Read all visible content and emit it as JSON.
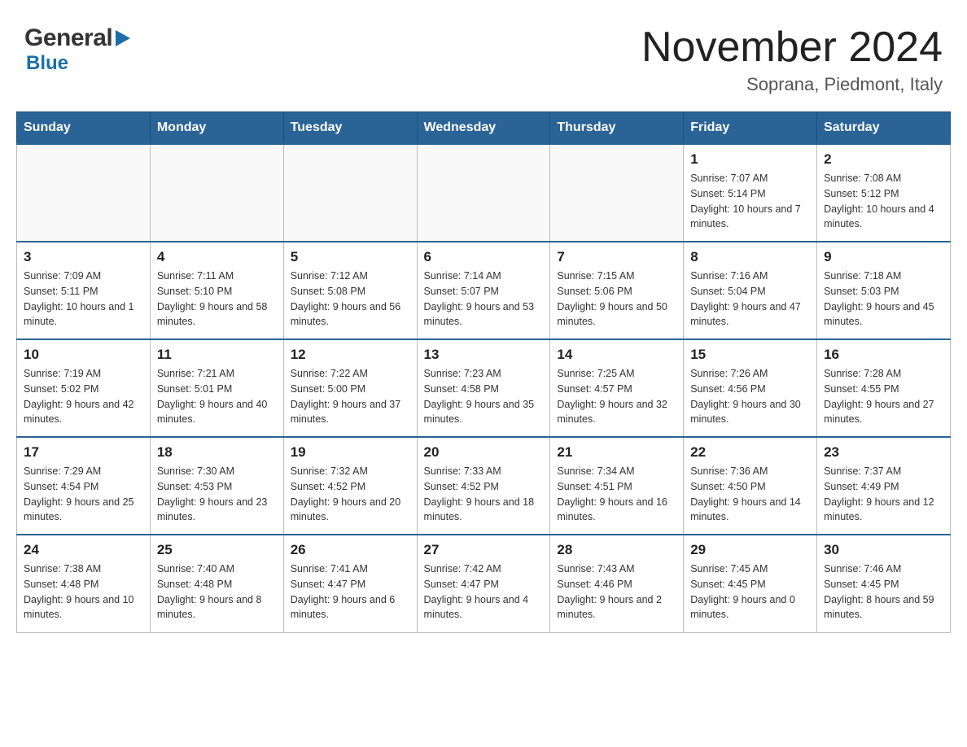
{
  "header": {
    "logo_general": "General",
    "logo_blue": "Blue",
    "month_title": "November 2024",
    "location": "Soprana, Piedmont, Italy"
  },
  "weekdays": [
    "Sunday",
    "Monday",
    "Tuesday",
    "Wednesday",
    "Thursday",
    "Friday",
    "Saturday"
  ],
  "weeks": [
    [
      {
        "day": "",
        "sunrise": "",
        "sunset": "",
        "daylight": ""
      },
      {
        "day": "",
        "sunrise": "",
        "sunset": "",
        "daylight": ""
      },
      {
        "day": "",
        "sunrise": "",
        "sunset": "",
        "daylight": ""
      },
      {
        "day": "",
        "sunrise": "",
        "sunset": "",
        "daylight": ""
      },
      {
        "day": "",
        "sunrise": "",
        "sunset": "",
        "daylight": ""
      },
      {
        "day": "1",
        "sunrise": "Sunrise: 7:07 AM",
        "sunset": "Sunset: 5:14 PM",
        "daylight": "Daylight: 10 hours and 7 minutes."
      },
      {
        "day": "2",
        "sunrise": "Sunrise: 7:08 AM",
        "sunset": "Sunset: 5:12 PM",
        "daylight": "Daylight: 10 hours and 4 minutes."
      }
    ],
    [
      {
        "day": "3",
        "sunrise": "Sunrise: 7:09 AM",
        "sunset": "Sunset: 5:11 PM",
        "daylight": "Daylight: 10 hours and 1 minute."
      },
      {
        "day": "4",
        "sunrise": "Sunrise: 7:11 AM",
        "sunset": "Sunset: 5:10 PM",
        "daylight": "Daylight: 9 hours and 58 minutes."
      },
      {
        "day": "5",
        "sunrise": "Sunrise: 7:12 AM",
        "sunset": "Sunset: 5:08 PM",
        "daylight": "Daylight: 9 hours and 56 minutes."
      },
      {
        "day": "6",
        "sunrise": "Sunrise: 7:14 AM",
        "sunset": "Sunset: 5:07 PM",
        "daylight": "Daylight: 9 hours and 53 minutes."
      },
      {
        "day": "7",
        "sunrise": "Sunrise: 7:15 AM",
        "sunset": "Sunset: 5:06 PM",
        "daylight": "Daylight: 9 hours and 50 minutes."
      },
      {
        "day": "8",
        "sunrise": "Sunrise: 7:16 AM",
        "sunset": "Sunset: 5:04 PM",
        "daylight": "Daylight: 9 hours and 47 minutes."
      },
      {
        "day": "9",
        "sunrise": "Sunrise: 7:18 AM",
        "sunset": "Sunset: 5:03 PM",
        "daylight": "Daylight: 9 hours and 45 minutes."
      }
    ],
    [
      {
        "day": "10",
        "sunrise": "Sunrise: 7:19 AM",
        "sunset": "Sunset: 5:02 PM",
        "daylight": "Daylight: 9 hours and 42 minutes."
      },
      {
        "day": "11",
        "sunrise": "Sunrise: 7:21 AM",
        "sunset": "Sunset: 5:01 PM",
        "daylight": "Daylight: 9 hours and 40 minutes."
      },
      {
        "day": "12",
        "sunrise": "Sunrise: 7:22 AM",
        "sunset": "Sunset: 5:00 PM",
        "daylight": "Daylight: 9 hours and 37 minutes."
      },
      {
        "day": "13",
        "sunrise": "Sunrise: 7:23 AM",
        "sunset": "Sunset: 4:58 PM",
        "daylight": "Daylight: 9 hours and 35 minutes."
      },
      {
        "day": "14",
        "sunrise": "Sunrise: 7:25 AM",
        "sunset": "Sunset: 4:57 PM",
        "daylight": "Daylight: 9 hours and 32 minutes."
      },
      {
        "day": "15",
        "sunrise": "Sunrise: 7:26 AM",
        "sunset": "Sunset: 4:56 PM",
        "daylight": "Daylight: 9 hours and 30 minutes."
      },
      {
        "day": "16",
        "sunrise": "Sunrise: 7:28 AM",
        "sunset": "Sunset: 4:55 PM",
        "daylight": "Daylight: 9 hours and 27 minutes."
      }
    ],
    [
      {
        "day": "17",
        "sunrise": "Sunrise: 7:29 AM",
        "sunset": "Sunset: 4:54 PM",
        "daylight": "Daylight: 9 hours and 25 minutes."
      },
      {
        "day": "18",
        "sunrise": "Sunrise: 7:30 AM",
        "sunset": "Sunset: 4:53 PM",
        "daylight": "Daylight: 9 hours and 23 minutes."
      },
      {
        "day": "19",
        "sunrise": "Sunrise: 7:32 AM",
        "sunset": "Sunset: 4:52 PM",
        "daylight": "Daylight: 9 hours and 20 minutes."
      },
      {
        "day": "20",
        "sunrise": "Sunrise: 7:33 AM",
        "sunset": "Sunset: 4:52 PM",
        "daylight": "Daylight: 9 hours and 18 minutes."
      },
      {
        "day": "21",
        "sunrise": "Sunrise: 7:34 AM",
        "sunset": "Sunset: 4:51 PM",
        "daylight": "Daylight: 9 hours and 16 minutes."
      },
      {
        "day": "22",
        "sunrise": "Sunrise: 7:36 AM",
        "sunset": "Sunset: 4:50 PM",
        "daylight": "Daylight: 9 hours and 14 minutes."
      },
      {
        "day": "23",
        "sunrise": "Sunrise: 7:37 AM",
        "sunset": "Sunset: 4:49 PM",
        "daylight": "Daylight: 9 hours and 12 minutes."
      }
    ],
    [
      {
        "day": "24",
        "sunrise": "Sunrise: 7:38 AM",
        "sunset": "Sunset: 4:48 PM",
        "daylight": "Daylight: 9 hours and 10 minutes."
      },
      {
        "day": "25",
        "sunrise": "Sunrise: 7:40 AM",
        "sunset": "Sunset: 4:48 PM",
        "daylight": "Daylight: 9 hours and 8 minutes."
      },
      {
        "day": "26",
        "sunrise": "Sunrise: 7:41 AM",
        "sunset": "Sunset: 4:47 PM",
        "daylight": "Daylight: 9 hours and 6 minutes."
      },
      {
        "day": "27",
        "sunrise": "Sunrise: 7:42 AM",
        "sunset": "Sunset: 4:47 PM",
        "daylight": "Daylight: 9 hours and 4 minutes."
      },
      {
        "day": "28",
        "sunrise": "Sunrise: 7:43 AM",
        "sunset": "Sunset: 4:46 PM",
        "daylight": "Daylight: 9 hours and 2 minutes."
      },
      {
        "day": "29",
        "sunrise": "Sunrise: 7:45 AM",
        "sunset": "Sunset: 4:45 PM",
        "daylight": "Daylight: 9 hours and 0 minutes."
      },
      {
        "day": "30",
        "sunrise": "Sunrise: 7:46 AM",
        "sunset": "Sunset: 4:45 PM",
        "daylight": "Daylight: 8 hours and 59 minutes."
      }
    ]
  ]
}
